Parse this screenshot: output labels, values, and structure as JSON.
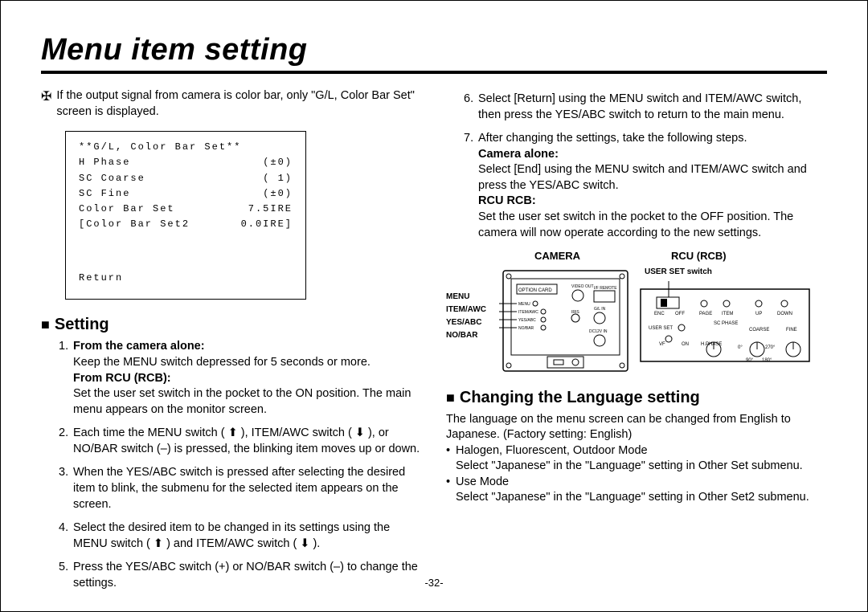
{
  "title": "Menu item setting",
  "left": {
    "note": "If the output signal from camera is color bar, only \"G/L, Color Bar Set\" screen is displayed.",
    "screen": {
      "header": "**G/L, Color Bar Set**",
      "r1l": "H Phase",
      "r1r": "(±0)",
      "r2l": "SC Coarse",
      "r2r": "( 1)",
      "r3l": "SC Fine",
      "r3r": "(±0)",
      "r4l": "Color Bar Set",
      "r4r": "7.5IRE",
      "r5l": "[Color Bar Set2",
      "r5r": "0.0IRE]",
      "ret": "Return"
    },
    "setting_head": "Setting",
    "i1": {
      "cam_bold": "From the camera alone:",
      "cam_txt": "Keep the MENU switch depressed for 5 seconds or more.",
      "rcu_bold": "From RCU (RCB):",
      "rcu_txt": "Set the user set switch in the pocket to the ON position. The main menu appears on the monitor screen."
    },
    "i2": "Each time the MENU switch ( ⬆ ), ITEM/AWC switch ( ⬇ ), or NO/BAR switch (–) is pressed, the blinking item moves up or down.",
    "i3": "When the YES/ABC switch is pressed after selecting the desired item to blink, the submenu for the selected item appears on the screen.",
    "i4": "Select the desired item to be changed in its settings using the MENU switch ( ⬆ ) and ITEM/AWC switch ( ⬇ ).",
    "i5": "Press the YES/ABC switch (+) or NO/BAR switch (–) to change the settings."
  },
  "right": {
    "i6": "Select [Return] using the MENU switch and ITEM/AWC switch, then press the YES/ABC switch to return to the main menu.",
    "i7_intro": "After changing the settings, take the following steps.",
    "i7_cam_bold": "Camera alone:",
    "i7_cam_txt": "Select [End] using the MENU switch and ITEM/AWC switch and press the YES/ABC switch.",
    "i7_rcu_bold": "RCU RCB:",
    "i7_rcu_txt": "Set the user set switch in the pocket to the OFF position. The camera will now operate according to the new settings.",
    "cam_label": "CAMERA",
    "rcu_label": "RCU (RCB)",
    "userset_label": "USER SET switch",
    "diag_l1": "MENU",
    "diag_l2": "ITEM/AWC",
    "diag_l3": "YES/ABC",
    "diag_l4": "NO/BAR",
    "lang_head": "Changing the Language setting",
    "lang_intro": "The language on the menu screen can be changed from English to Japanese. (Factory setting: English)",
    "lang_b1": "Halogen, Fluorescent, Outdoor Mode",
    "lang_b1_txt": "Select \"Japanese\" in the \"Language\" setting in Other Set submenu.",
    "lang_b2": "Use Mode",
    "lang_b2_txt": "Select \"Japanese\" in the \"Language\" setting in Other Set2 submenu."
  },
  "pagenum": "-32-"
}
